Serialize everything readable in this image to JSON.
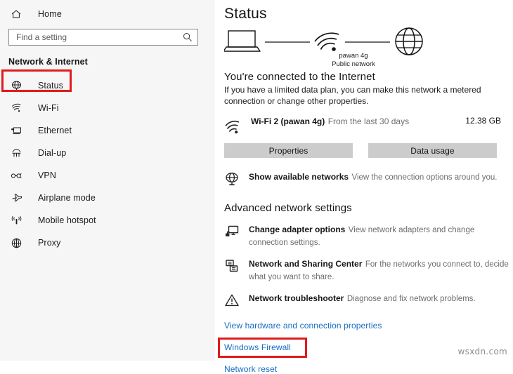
{
  "sidebar": {
    "home_label": "Home",
    "search": {
      "placeholder": "Find a setting",
      "value": "",
      "icon": "search-icon"
    },
    "category_title": "Network & Internet",
    "items": [
      {
        "label": "Status",
        "icon": "globe-status-icon",
        "selected": true
      },
      {
        "label": "Wi-Fi",
        "icon": "wifi-icon",
        "selected": false
      },
      {
        "label": "Ethernet",
        "icon": "ethernet-icon",
        "selected": false
      },
      {
        "label": "Dial-up",
        "icon": "dialup-icon",
        "selected": false
      },
      {
        "label": "VPN",
        "icon": "vpn-icon",
        "selected": false
      },
      {
        "label": "Airplane mode",
        "icon": "airplane-icon",
        "selected": false
      },
      {
        "label": "Mobile hotspot",
        "icon": "hotspot-icon",
        "selected": false
      },
      {
        "label": "Proxy",
        "icon": "proxy-globe-icon",
        "selected": false
      }
    ]
  },
  "main": {
    "title": "Status",
    "diagram": {
      "device_icon": "laptop-icon",
      "network_icon": "wifi-icon",
      "internet_icon": "globe-icon",
      "network_name": "pawan 4g",
      "network_type": "Public network"
    },
    "connection": {
      "headline": "You're connected to the Internet",
      "description": "If you have a limited data plan, you can make this network a metered connection or change other properties."
    },
    "usage": {
      "icon": "wifi-icon",
      "name": "Wi-Fi 2 (pawan 4g)",
      "period": "From the last 30 days",
      "amount": "12.38 GB"
    },
    "buttons": [
      {
        "label": "Properties"
      },
      {
        "label": "Data usage"
      }
    ],
    "available_networks": {
      "icon": "globe-networks-icon",
      "title": "Show available networks",
      "subtitle": "View the connection options around you."
    },
    "advanced_title": "Advanced network settings",
    "advanced_items": [
      {
        "icon": "adapter-icon",
        "title": "Change adapter options",
        "subtitle": "View network adapters and change connection settings."
      },
      {
        "icon": "sharing-icon",
        "title": "Network and Sharing Center",
        "subtitle": "For the networks you connect to, decide what you want to share."
      },
      {
        "icon": "troubleshooter-warning-icon",
        "title": "Network troubleshooter",
        "subtitle": "Diagnose and fix network problems."
      }
    ],
    "links": [
      {
        "label": "View hardware and connection properties",
        "highlighted": false
      },
      {
        "label": "Windows Firewall",
        "highlighted": false
      },
      {
        "label": "Network reset",
        "highlighted": true
      }
    ]
  },
  "watermark": "wsxdn.com",
  "colors": {
    "highlight_red": "#e01b1b",
    "link_blue": "#176dc2",
    "button_gray": "#cccccc",
    "sidebar_bg": "#f6f6f6"
  }
}
